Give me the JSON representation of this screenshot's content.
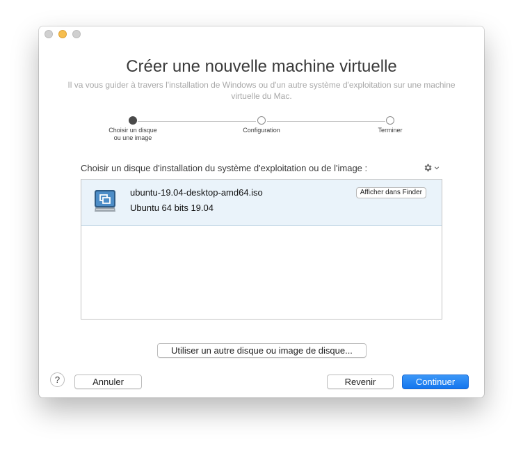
{
  "window": {
    "title": "Créer une nouvelle machine virtuelle",
    "subtitle": "Il va vous guider à travers l'installation de Windows ou d'un autre système d'exploitation sur une machine virtuelle du Mac."
  },
  "steps": [
    {
      "label": "Choisir un disque ou une image",
      "state": "active"
    },
    {
      "label": "Configuration",
      "state": "pending"
    },
    {
      "label": "Terminer",
      "state": "pending"
    }
  ],
  "section": {
    "label": "Choisir un disque d'installation du système d'exploitation ou de l'image :",
    "settings_icon": "gear-icon"
  },
  "disk_list": {
    "items": [
      {
        "name": "ubuntu-19.04-desktop-amd64.iso",
        "os": "Ubuntu 64 bits 19.04",
        "icon": "disk-image-icon",
        "reveal_button": "Afficher dans Finder",
        "selected": true
      }
    ]
  },
  "buttons": {
    "other_disk": "Utiliser un autre disque ou image de disque...",
    "help": "?",
    "cancel": "Annuler",
    "back": "Revenir",
    "continue": "Continuer"
  },
  "colors": {
    "accent": "#1a7ff0",
    "selection_bg": "#eaf3fa",
    "minimize": "#f6be4f"
  }
}
